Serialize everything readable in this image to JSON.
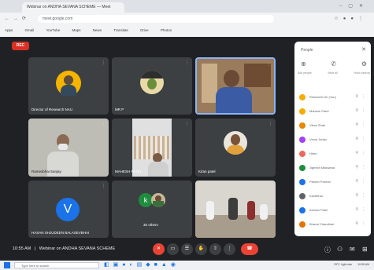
{
  "browser": {
    "tab_title": "Webinar on ANDHA SEVANA SCHEME — Meet",
    "url": "meet.google.com",
    "bookmarks": [
      "Apps",
      "Gmail",
      "YouTube",
      "Maps",
      "News",
      "Translate",
      "Drive",
      "Photos"
    ]
  },
  "meeting": {
    "rec_label": "REC",
    "tiles": [
      {
        "name": "Director of Research NAU"
      },
      {
        "name": "MR P"
      },
      {
        "name": ""
      },
      {
        "name": "Ramesbhai Sanjay"
      },
      {
        "name": "MAHESH PATEL"
      },
      {
        "name": "Kiran patel"
      },
      {
        "name": "HASAN SHJUDEEN BALASEVBHAI",
        "avatar_letter": "V"
      },
      {
        "name": "30 others",
        "avatar_letter": "K"
      },
      {
        "name": ""
      }
    ]
  },
  "panel": {
    "title": "People",
    "close_icon": "close-icon",
    "actions": [
      "Add people",
      "Mute all",
      "Host controls"
    ],
    "participants": [
      {
        "name": "Research Dir (You)",
        "color": "#f9ab00"
      },
      {
        "name": "Mahesh Patel",
        "color": "#f9ab00"
      },
      {
        "name": "Vikas Shah",
        "color": "#ea8600"
      },
      {
        "name": "Vinod Jadav",
        "color": "#a142f4"
      },
      {
        "name": "Hiren",
        "color": "#ee675c"
      },
      {
        "name": "Jignesh Makwana",
        "color": "#1e8e3e"
      },
      {
        "name": "Paresh Parmar",
        "color": "#1a73e8"
      },
      {
        "name": "Kantibhai",
        "color": "#5f6368"
      },
      {
        "name": "Ashwin Patel",
        "color": "#1a73e8"
      },
      {
        "name": "Bharat Chaudhari",
        "color": "#e37400"
      }
    ]
  },
  "bottom": {
    "time": "10:55 AM",
    "separator": "|",
    "title": "Webinar on ANDHA SEVANA SCHEME"
  },
  "taskbar": {
    "search_placeholder": "Type here to search",
    "weather": "29°C  Light rain",
    "clock": "10:55 AM"
  }
}
